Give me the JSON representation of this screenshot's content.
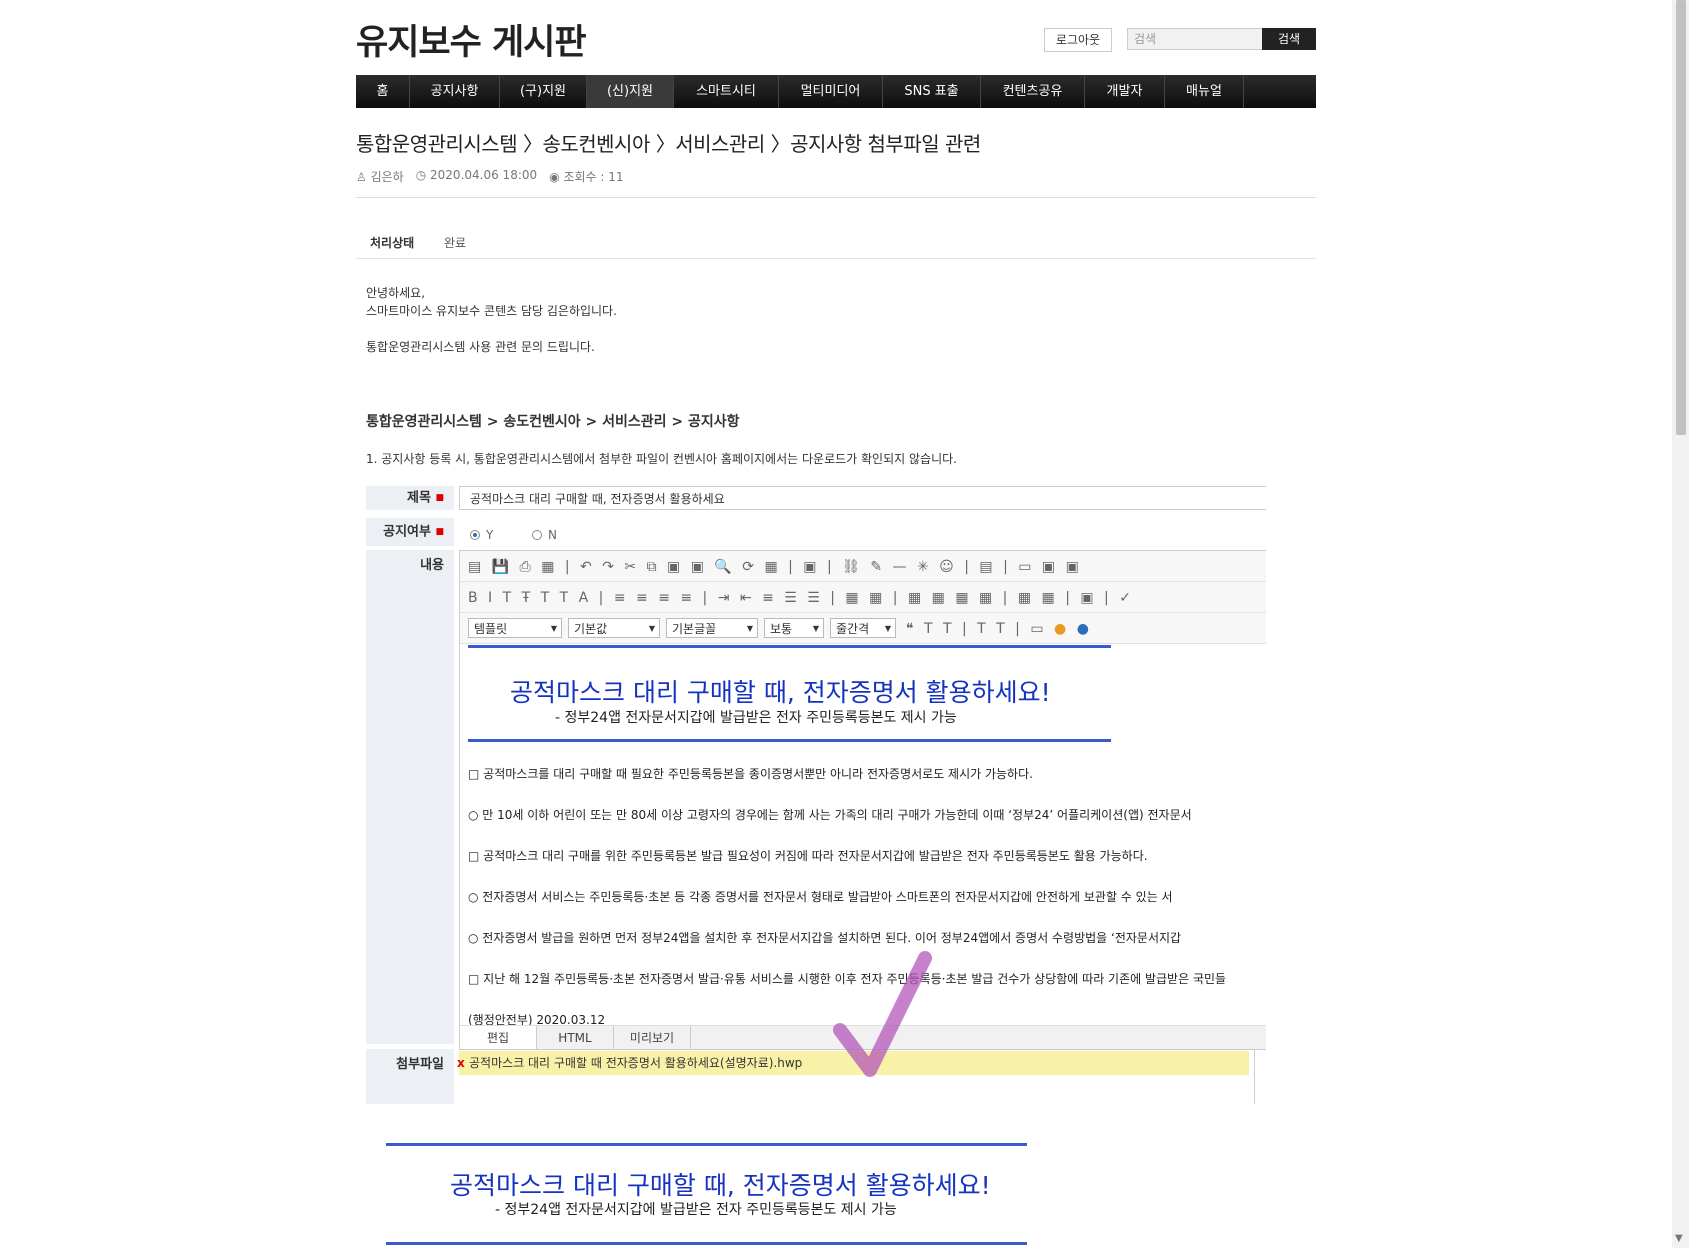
{
  "header": {
    "site_title": "유지보수 게시판",
    "logout_label": "로그아웃",
    "search_placeholder": "검색",
    "search_button": "검색"
  },
  "nav": {
    "items": [
      "홈",
      "공지사항",
      "(구)지원",
      "(신)지원",
      "스마트시티",
      "멀티미디어",
      "SNS 표출",
      "컨텐츠공유",
      "개발자",
      "매뉴얼"
    ],
    "active_index": 3
  },
  "post": {
    "breadcrumb_title": "통합운영관리시스템 〉송도컨벤시아 〉서비스관리 〉공지사항 첨부파일 관련",
    "author": "김은하",
    "datetime": "2020.04.06 18:00",
    "views": "조회수 : 11",
    "status_label": "처리상태",
    "status_value": "완료",
    "body_lines": [
      "안녕하세요,",
      "스마트마이스 유지보수 콘텐츠 담당 김은하입니다.",
      "",
      "통합운영관리시스템 사용 관련 문의 드립니다."
    ],
    "path_line": "통합운영관리시스템 > 송도컨벤시아 > 서비스관리 > 공지사항",
    "note_line": "1. 공지사항 등록 시, 통합운영관리시스템에서 첨부한 파일이 컨벤시아 홈페이지에서는 다운로드가 확인되지 않습니다."
  },
  "form": {
    "subject_label": "제목",
    "subject_value": "공적마스크 대리 구매할 때, 전자증명서 활용하세요",
    "notice_label": "공지여부",
    "notice_options": [
      "Y",
      "N"
    ],
    "notice_selected": "Y",
    "content_label": "내용",
    "attach_label": "첨부파일",
    "attach_file": "공적마스크 대리 구매할 때 전자증명서 활용하세요(설명자료).hwp",
    "attach_remove": "x"
  },
  "editor": {
    "select_template": "템플릿",
    "select_style": "기본값",
    "select_font": "기본글꼴",
    "select_size": "보통",
    "select_spacing": "줄간격",
    "mode_tabs": [
      "편집",
      "HTML",
      "미리보기"
    ],
    "doc_title": "공적마스크 대리 구매할 때, 전자증명서 활용하세요!",
    "doc_subtitle": "- 정부24앱 전자문서지갑에 발급받은 전자 주민등록등본도 제시 가능",
    "doc_lines": [
      "□ 공적마스크를 대리 구매할 때 필요한 주민등록등본을 종이증명서뿐만 아니라 전자증명서로도 제시가 가능하다.",
      "○ 만 10세 이하 어린이 또는 만 80세 이상 고령자의 경우에는 함께 사는 가족의 대리 구매가 가능한데 이때 ‘정부24’ 어플리케이션(앱) 전자문서",
      "□ 공적마스크 대리 구매를 위한 주민등록등본 발급 필요성이 커짐에 따라 전자문서지갑에 발급받은 전자 주민등록등본도 활용 가능하다.",
      "○ 전자증명서 서비스는 주민등록등·초본 등 각종 증명서를 전자문서 형태로 발급받아 스마트폰의 전자문서지갑에 안전하게 보관할 수 있는 서",
      "○ 전자증명서 발급을 원하면 먼저 정부24앱을 설치한 후 전자문서지갑을 설치하면 된다. 이어 정부24앱에서 증명서 수령방법을 ‘전자문서지갑",
      "□ 지난 해 12월 주민등록등·초본 전자증명서 발급·유통 서비스를 시행한 이후 전자 주민등록등·초본 발급 건수가 상당함에 따라 기존에 발급받은 국민들",
      "(행정안전부) 2020.03.12"
    ]
  },
  "lower_preview": {
    "title": "공적마스크 대리 구매할 때, 전자증명서 활용하세요!",
    "subtitle": "- 정부24앱 전자문서지갑에 발급받은 전자 주민등록등본도 제시 가능"
  },
  "colors": {
    "accent_blue": "#1533c0",
    "rule_blue": "#3a5bd0",
    "nav_bg": "#1a1a1a",
    "attach_highlight": "#f8f2a8",
    "annotation_arrow": "#b455b8"
  },
  "icons": [
    "user-icon",
    "clock-icon",
    "eye-icon",
    "annotation-arrow-icon"
  ]
}
